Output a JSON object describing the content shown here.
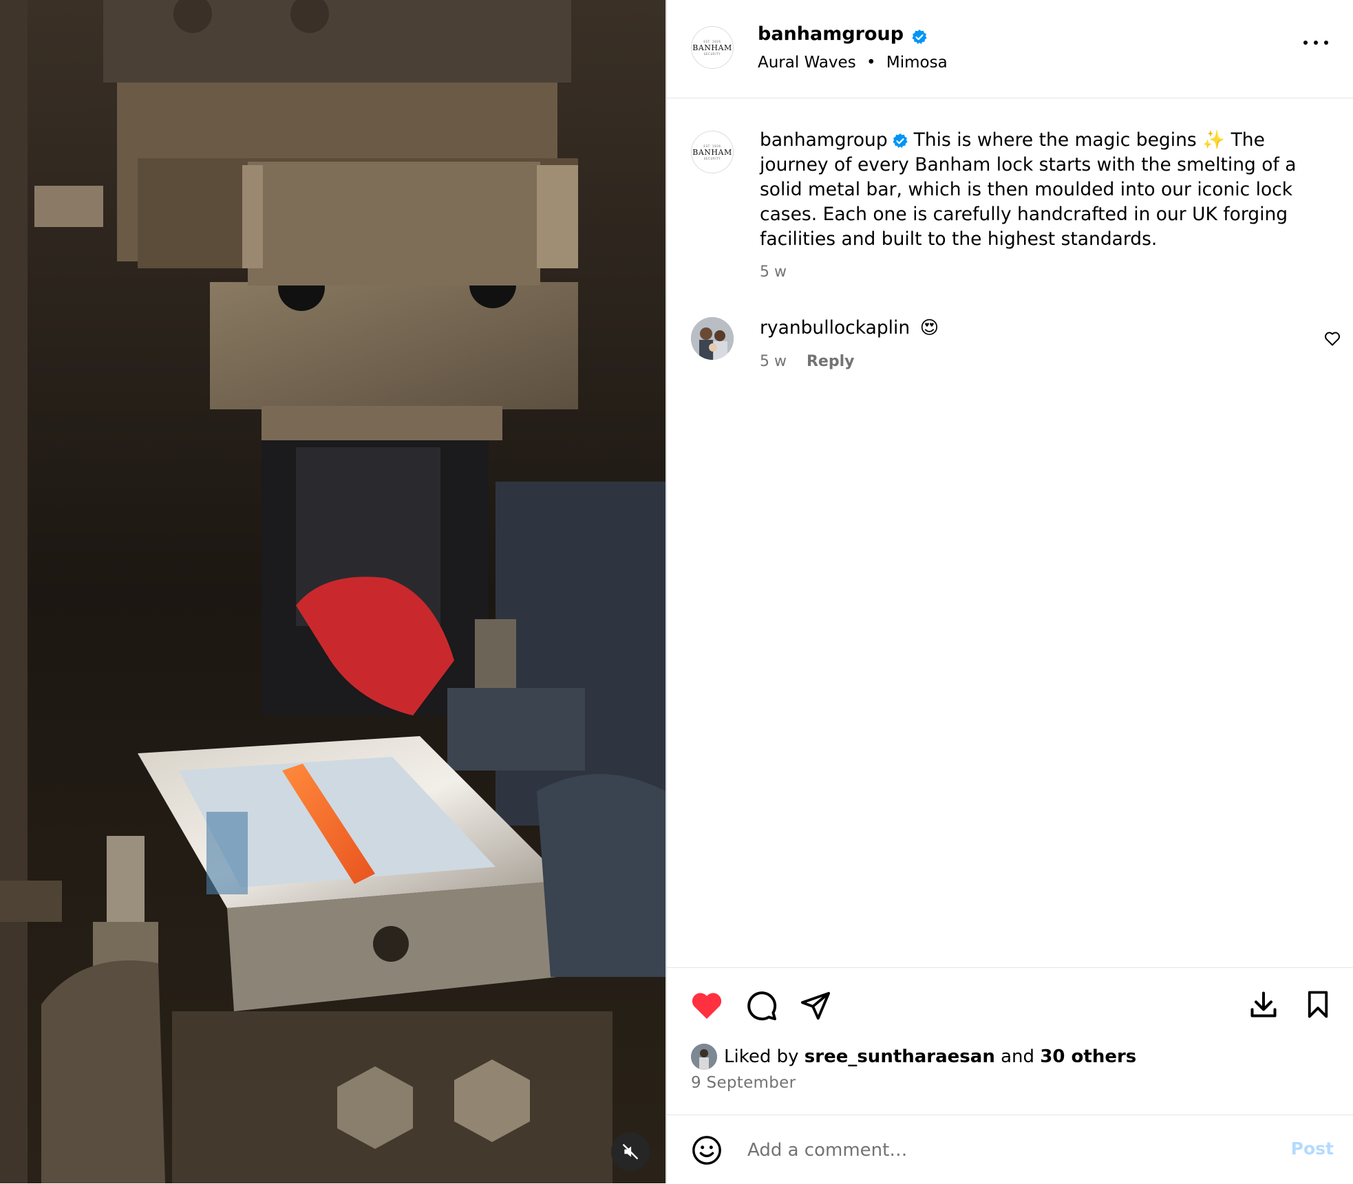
{
  "post": {
    "username": "banhamgroup",
    "audio": "Aural Waves",
    "separator": "•",
    "location": "Mimosa",
    "avatar_brand": "BANHAM"
  },
  "caption": {
    "username": "banhamgroup",
    "text_before_emoji": "This is where the magic begins",
    "emoji": "✨",
    "text_after_emoji": "The journey of every Banham lock starts with the smelting of a solid metal bar, which is then moulded into our iconic lock cases. Each one is carefully handcrafted in our UK forging facilities and built to the highest standards.",
    "age": "5 w"
  },
  "comments": [
    {
      "username": "ryanbullockaplin",
      "emoji": "😍",
      "age": "5 w",
      "reply_label": "Reply"
    }
  ],
  "likes": {
    "prefix": "Liked by",
    "user": "sree_suntharaesan",
    "and": "and",
    "others": "30 others"
  },
  "date": "9 September",
  "compose": {
    "placeholder": "Add a comment…",
    "post_label": "Post"
  },
  "colors": {
    "like_red": "#ff3040",
    "verified_blue": "#0095f6",
    "post_disabled": "#b3dbff",
    "muted_text": "#737373"
  },
  "icons": {
    "verified": "verified-badge-icon",
    "more": "more-options-icon",
    "like": "heart-filled-icon",
    "comment": "comment-bubble-icon",
    "share": "share-paper-plane-icon",
    "download": "download-icon",
    "save": "bookmark-icon",
    "emoji": "emoji-smiley-icon",
    "mute": "speaker-muted-icon"
  }
}
